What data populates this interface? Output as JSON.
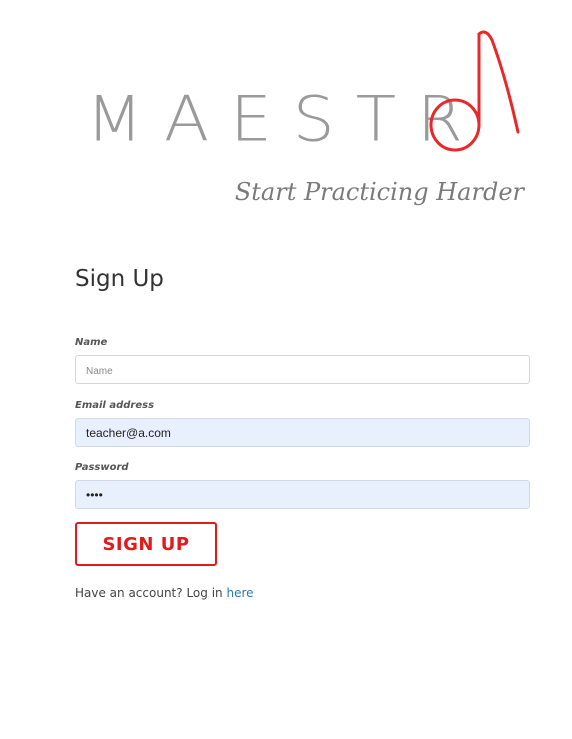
{
  "logo": {
    "text": "MAESTR",
    "note_color": "#e8282b",
    "text_color": "#9a9a9a"
  },
  "tagline": "Start Practicing Harder",
  "form": {
    "title": "Sign Up",
    "name": {
      "label": "Name",
      "placeholder": "Name",
      "value": ""
    },
    "email": {
      "label": "Email address",
      "value": "teacher@a.com"
    },
    "password": {
      "label": "Password",
      "value": "1234"
    },
    "submit_label": "SIGN UP",
    "submit_color": "#e01b1b"
  },
  "login": {
    "prompt": "Have an account? Log in",
    "link_text": "here",
    "link_color": "#2a7ab0"
  }
}
